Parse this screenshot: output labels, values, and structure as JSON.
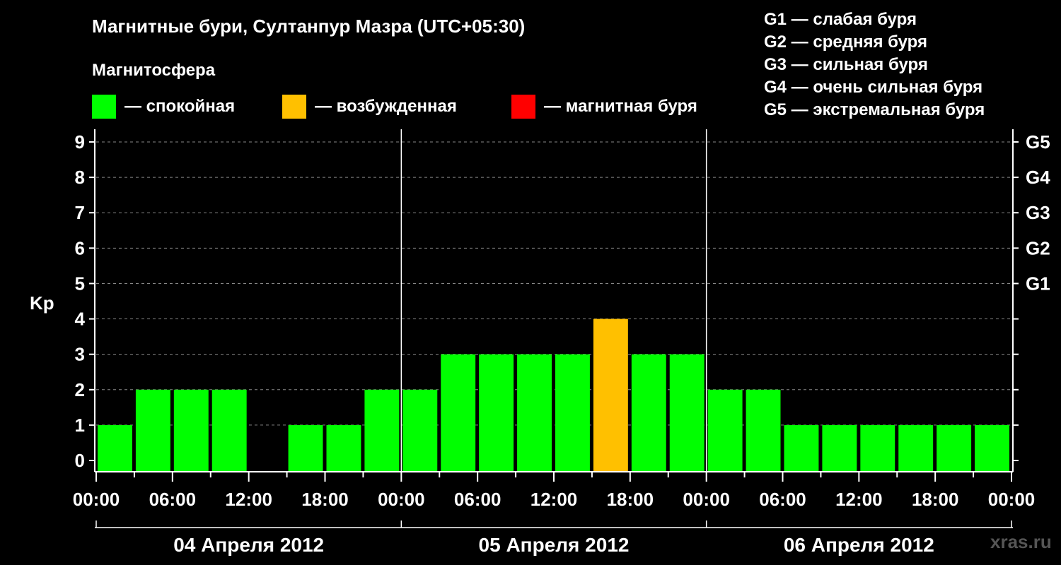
{
  "header": {
    "title": "Магнитные бури, Султанпур Мазра (UTC+05:30)",
    "subtitle": "Магнитосфера"
  },
  "legend": [
    {
      "label": "— спокойная",
      "color": "#00ff00"
    },
    {
      "label": "— возбужденная",
      "color": "#ffc000"
    },
    {
      "label": "— магнитная буря",
      "color": "#ff0000"
    }
  ],
  "storm_scale": [
    "G1 — слабая буря",
    "G2 — средняя буря",
    "G3 — сильная буря",
    "G4 — очень сильная буря",
    "G5 — экстремальная буря"
  ],
  "watermark": "xras.ru",
  "chart_data": {
    "type": "bar",
    "ylabel": "Kp",
    "ylim": [
      0,
      9
    ],
    "yticks": [
      "0",
      "1",
      "2",
      "3",
      "4",
      "5",
      "6",
      "7",
      "8",
      "9"
    ],
    "y2ticks": [
      {
        "label": "G1",
        "value": 5
      },
      {
        "label": "G2",
        "value": 6
      },
      {
        "label": "G3",
        "value": 7
      },
      {
        "label": "G4",
        "value": 8
      },
      {
        "label": "G5",
        "value": 9
      }
    ],
    "xtick_labels": [
      "00:00",
      "06:00",
      "12:00",
      "18:00",
      "00:00",
      "06:00",
      "12:00",
      "18:00",
      "00:00",
      "06:00",
      "12:00",
      "18:00",
      "00:00"
    ],
    "days": [
      "04 Апреля 2012",
      "05 Апреля 2012",
      "06 Апреля 2012"
    ],
    "grid": true,
    "bar_values": [
      1,
      2,
      2,
      2,
      0,
      1,
      1,
      2,
      2,
      3,
      3,
      3,
      3,
      4,
      3,
      3,
      2,
      2,
      1,
      1,
      1,
      1,
      1,
      1
    ],
    "bar_colors": [
      "#00ff00",
      "#00ff00",
      "#00ff00",
      "#00ff00",
      "#00ff00",
      "#00ff00",
      "#00ff00",
      "#00ff00",
      "#00ff00",
      "#00ff00",
      "#00ff00",
      "#00ff00",
      "#00ff00",
      "#ffc000",
      "#00ff00",
      "#00ff00",
      "#00ff00",
      "#00ff00",
      "#00ff00",
      "#00ff00",
      "#00ff00",
      "#00ff00",
      "#00ff00",
      "#00ff00"
    ]
  }
}
